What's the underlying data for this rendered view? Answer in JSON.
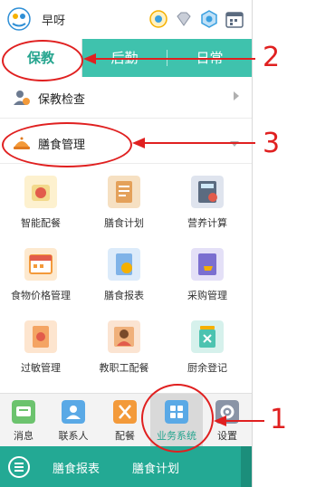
{
  "header": {
    "greeting": "早呀",
    "icons": [
      "logo-icon",
      "location-icon",
      "diamond-icon",
      "hexagon-icon",
      "calendar-icon"
    ]
  },
  "tabs": [
    {
      "label": "保教",
      "active": true
    },
    {
      "label": "后勤",
      "active": false
    },
    {
      "label": "日常",
      "active": false
    }
  ],
  "sections": [
    {
      "label": "保教检查",
      "icon": "person-check-icon",
      "expanded": false
    },
    {
      "label": "膳食管理",
      "icon": "food-cover-icon",
      "expanded": true
    }
  ],
  "grid": [
    {
      "label": "智能配餐",
      "icon": "scale-icon",
      "color": "#f3d98b"
    },
    {
      "label": "膳食计划",
      "icon": "clipboard-icon",
      "color": "#e4a15a"
    },
    {
      "label": "营养计算",
      "icon": "calculator-icon",
      "color": "#7a8aa8"
    },
    {
      "label": "食物价格管理",
      "icon": "calendar-price-icon",
      "color": "#f5b76b"
    },
    {
      "label": "膳食报表",
      "icon": "report-icon",
      "color": "#7fb3e8"
    },
    {
      "label": "采购管理",
      "icon": "cart-icon",
      "color": "#7b6fd0"
    },
    {
      "label": "过敏管理",
      "icon": "allergy-icon",
      "color": "#f4a463"
    },
    {
      "label": "教职工配餐",
      "icon": "staff-meal-icon",
      "color": "#f0b07a"
    },
    {
      "label": "厨余登记",
      "icon": "trash-icon",
      "color": "#4cc3b0"
    }
  ],
  "bottom_nav": [
    {
      "label": "消息",
      "icon": "message-icon",
      "color": "#6cc36e",
      "active": false
    },
    {
      "label": "联系人",
      "icon": "contacts-icon",
      "color": "#5aa9e6",
      "active": false
    },
    {
      "label": "配餐",
      "icon": "fork-knife-icon",
      "color": "#f39a3a",
      "active": false
    },
    {
      "label": "业务系统",
      "icon": "apps-icon",
      "color": "#5aa9e6",
      "active": true
    },
    {
      "label": "设置",
      "icon": "settings-icon",
      "color": "#8a94a6",
      "active": false
    }
  ],
  "bottom_bar": {
    "links": [
      "膳食报表",
      "膳食计划"
    ]
  },
  "annotations": [
    "1",
    "2",
    "3"
  ],
  "colors": {
    "accent": "#3fc2ad",
    "annotation": "#e02020"
  }
}
